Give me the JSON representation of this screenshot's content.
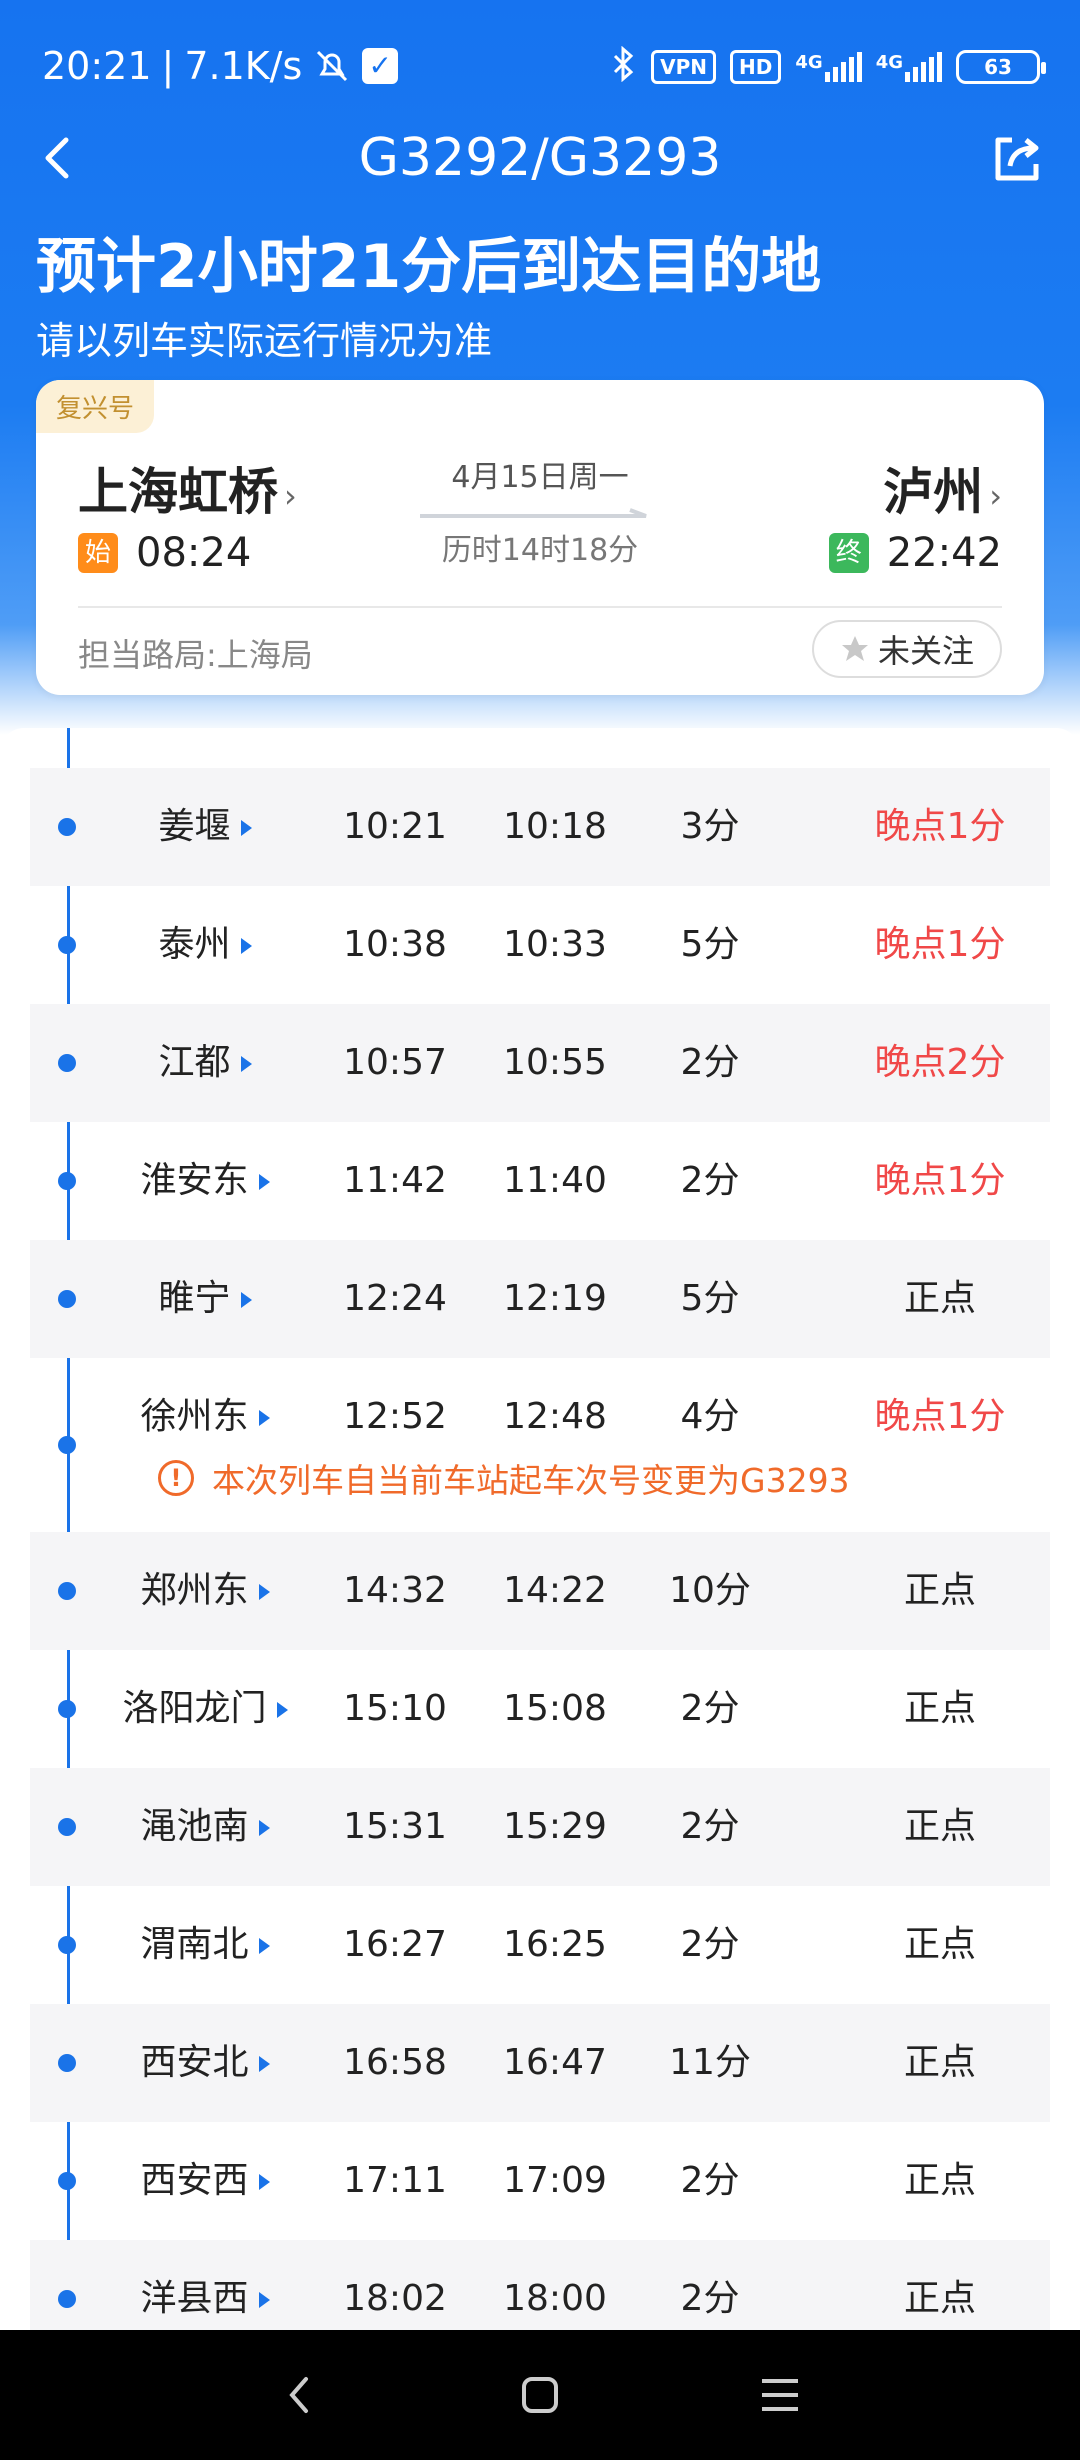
{
  "status_bar": {
    "time": "20:21",
    "separator": "|",
    "net_speed": "7.1K/s",
    "vpn_label": "VPN",
    "hd_label": "HD",
    "sim1_label": "4G",
    "sim2_label": "4G",
    "battery": "63"
  },
  "nav": {
    "title": "G3292/G3293"
  },
  "eta": {
    "headline": "预计2小时21分后到达目的地",
    "note": "请以列车实际运行情况为准"
  },
  "train_card": {
    "type_badge": "复兴号",
    "from_station": "上海虹桥",
    "to_station": "泸州",
    "chevron": "›",
    "depart_tag": "始",
    "depart_time": "08:24",
    "arrive_tag": "终",
    "arrive_time": "22:42",
    "date": "4月15日周一",
    "duration": "历时14时18分",
    "bureau": "担当路局:上海局",
    "follow_label": "未关注"
  },
  "timetable": {
    "rows": [
      {
        "name": "姜堰",
        "arrive": "10:21",
        "depart": "10:18",
        "stop": "3分",
        "status": "晚点1分",
        "late": true
      },
      {
        "name": "泰州",
        "arrive": "10:38",
        "depart": "10:33",
        "stop": "5分",
        "status": "晚点1分",
        "late": true
      },
      {
        "name": "江都",
        "arrive": "10:57",
        "depart": "10:55",
        "stop": "2分",
        "status": "晚点2分",
        "late": true
      },
      {
        "name": "淮安东",
        "arrive": "11:42",
        "depart": "11:40",
        "stop": "2分",
        "status": "晚点1分",
        "late": true
      },
      {
        "name": "睢宁",
        "arrive": "12:24",
        "depart": "12:19",
        "stop": "5分",
        "status": "正点",
        "late": false
      },
      {
        "name": "徐州东",
        "arrive": "12:52",
        "depart": "12:48",
        "stop": "4分",
        "status": "晚点1分",
        "late": true
      },
      {
        "name": "郑州东",
        "arrive": "14:32",
        "depart": "14:22",
        "stop": "10分",
        "status": "正点",
        "late": false
      },
      {
        "name": "洛阳龙门",
        "arrive": "15:10",
        "depart": "15:08",
        "stop": "2分",
        "status": "正点",
        "late": false
      },
      {
        "name": "渑池南",
        "arrive": "15:31",
        "depart": "15:29",
        "stop": "2分",
        "status": "正点",
        "late": false
      },
      {
        "name": "渭南北",
        "arrive": "16:27",
        "depart": "16:25",
        "stop": "2分",
        "status": "正点",
        "late": false
      },
      {
        "name": "西安北",
        "arrive": "16:58",
        "depart": "16:47",
        "stop": "11分",
        "status": "正点",
        "late": false
      },
      {
        "name": "西安西",
        "arrive": "17:11",
        "depart": "17:09",
        "stop": "2分",
        "status": "正点",
        "late": false
      },
      {
        "name": "洋县西",
        "arrive": "18:02",
        "depart": "18:00",
        "stop": "2分",
        "status": "正点",
        "late": false
      }
    ],
    "notice": "本次列车自当前车站起车次号变更为G3293",
    "notice_icon": "!"
  },
  "colors": {
    "primary_blue": "#1673f0",
    "late_red": "#f04848",
    "notice_orange": "#f06a2a",
    "start_tag": "#ff8c1a",
    "end_tag": "#3cb85c"
  }
}
